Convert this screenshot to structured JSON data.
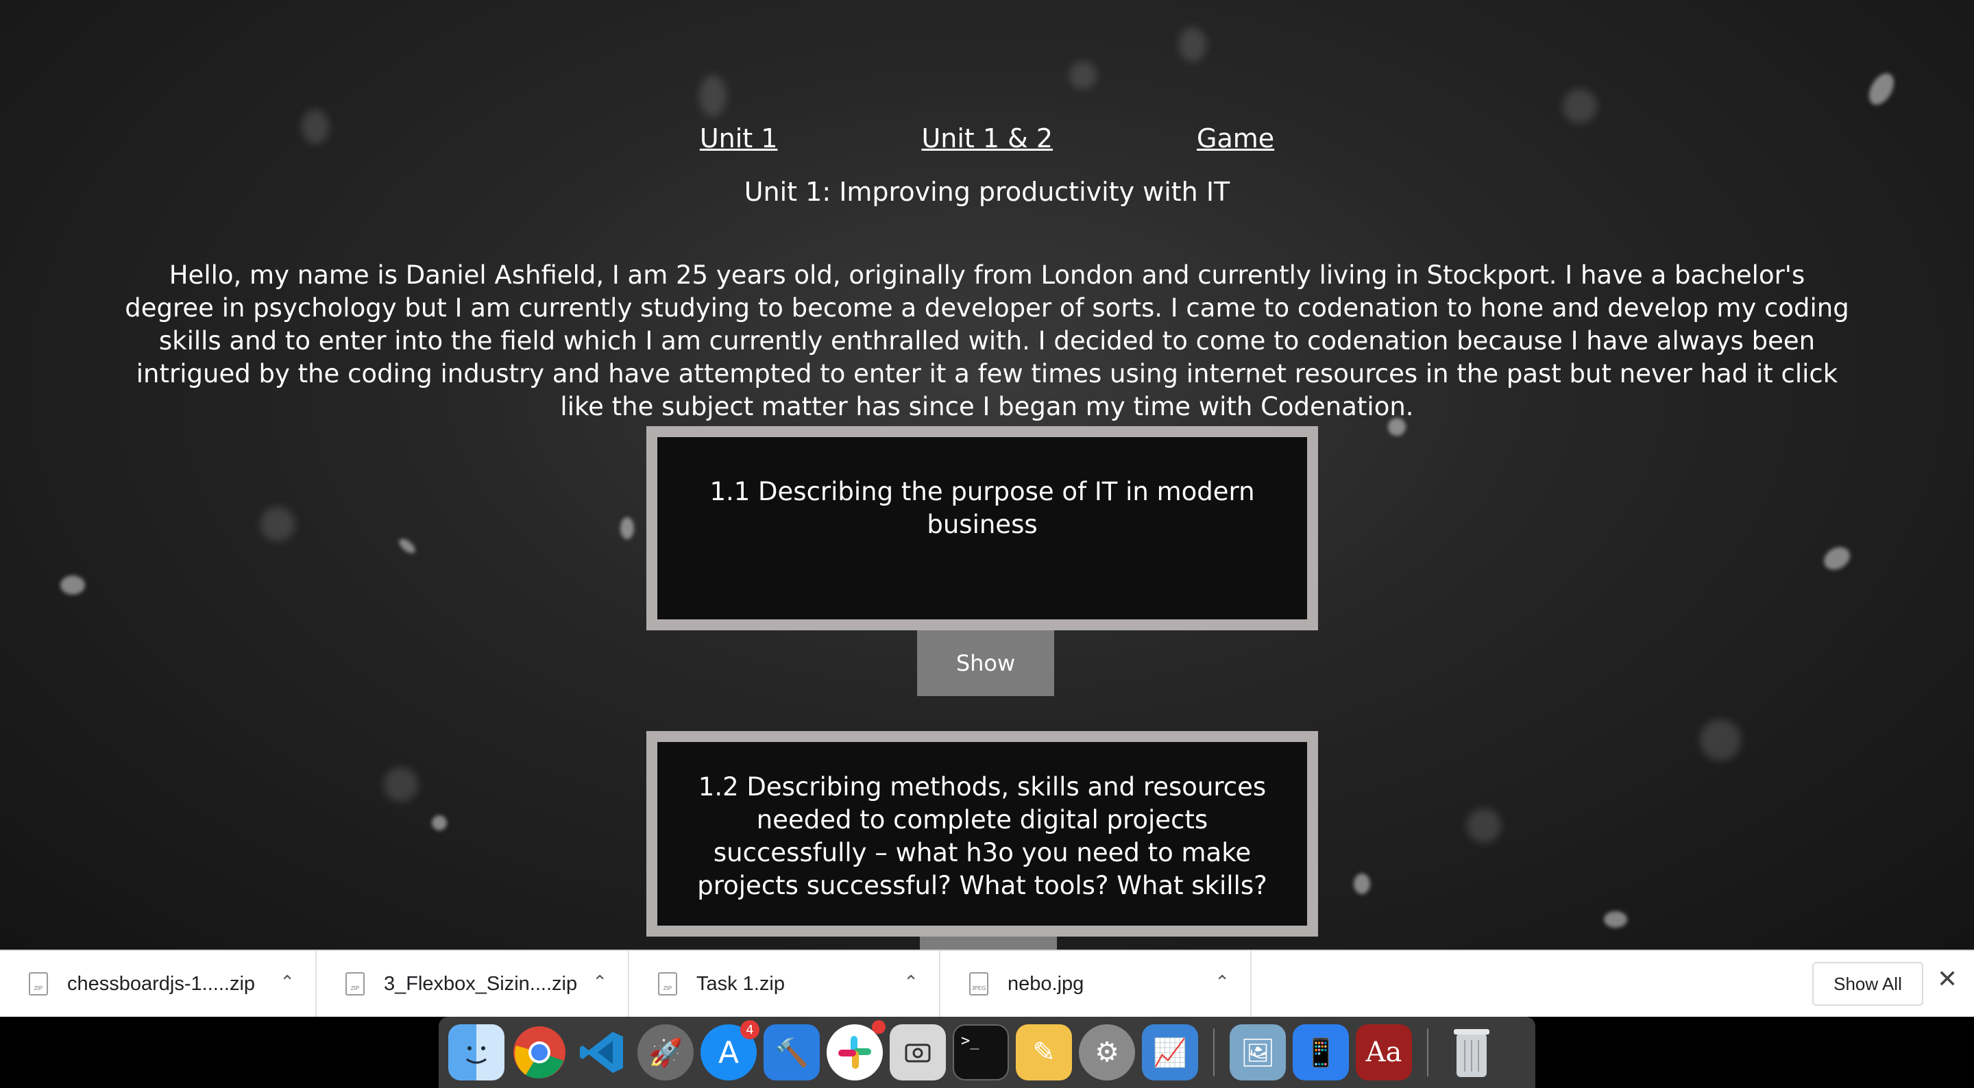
{
  "nav": {
    "links": [
      "Unit 1",
      "Unit 1 & 2",
      "Game"
    ]
  },
  "page": {
    "title": "Unit 1: Improving productivity with IT",
    "intro": "Hello, my name is Daniel Ashfield, I am 25 years old, originally from London and currently living in Stockport. I have a bachelor's degree in psychology but I am currently studying to become a developer of sorts. I came to codenation to hone and develop my coding skills and to enter into the field which I am currently enthralled with. I decided to come to codenation because I have always been intrigued by the coding industry and have attempted to enter it a few times using internet resources in the past but never had it click like the subject matter has since I began my time with Codenation.",
    "sections": [
      {
        "heading": "1.1 Describing the purpose of IT in modern business",
        "button": "Show"
      },
      {
        "heading": "1.2 Describing methods, skills and resources needed to complete digital projects successfully – what h3o you need to make projects successful? What tools? What skills?"
      }
    ]
  },
  "downloads": {
    "items": [
      {
        "name": "chessboardjs-1.....zip",
        "icon": "zip-file-icon",
        "type": "ZIP"
      },
      {
        "name": "3_Flexbox_Sizin....zip",
        "icon": "zip-file-icon",
        "type": "ZIP"
      },
      {
        "name": "Task 1.zip",
        "icon": "zip-file-icon",
        "type": "ZIP"
      },
      {
        "name": "nebo.jpg",
        "icon": "jpeg-file-icon",
        "type": "JPEG"
      }
    ],
    "show_all": "Show All"
  },
  "dock": {
    "badges": {
      "app_store": "4"
    },
    "dictionary_label": "Aa"
  },
  "colors": {
    "box_border": "#b3aeae",
    "button_bg": "#7c7c7c",
    "badge": "#e53935"
  }
}
